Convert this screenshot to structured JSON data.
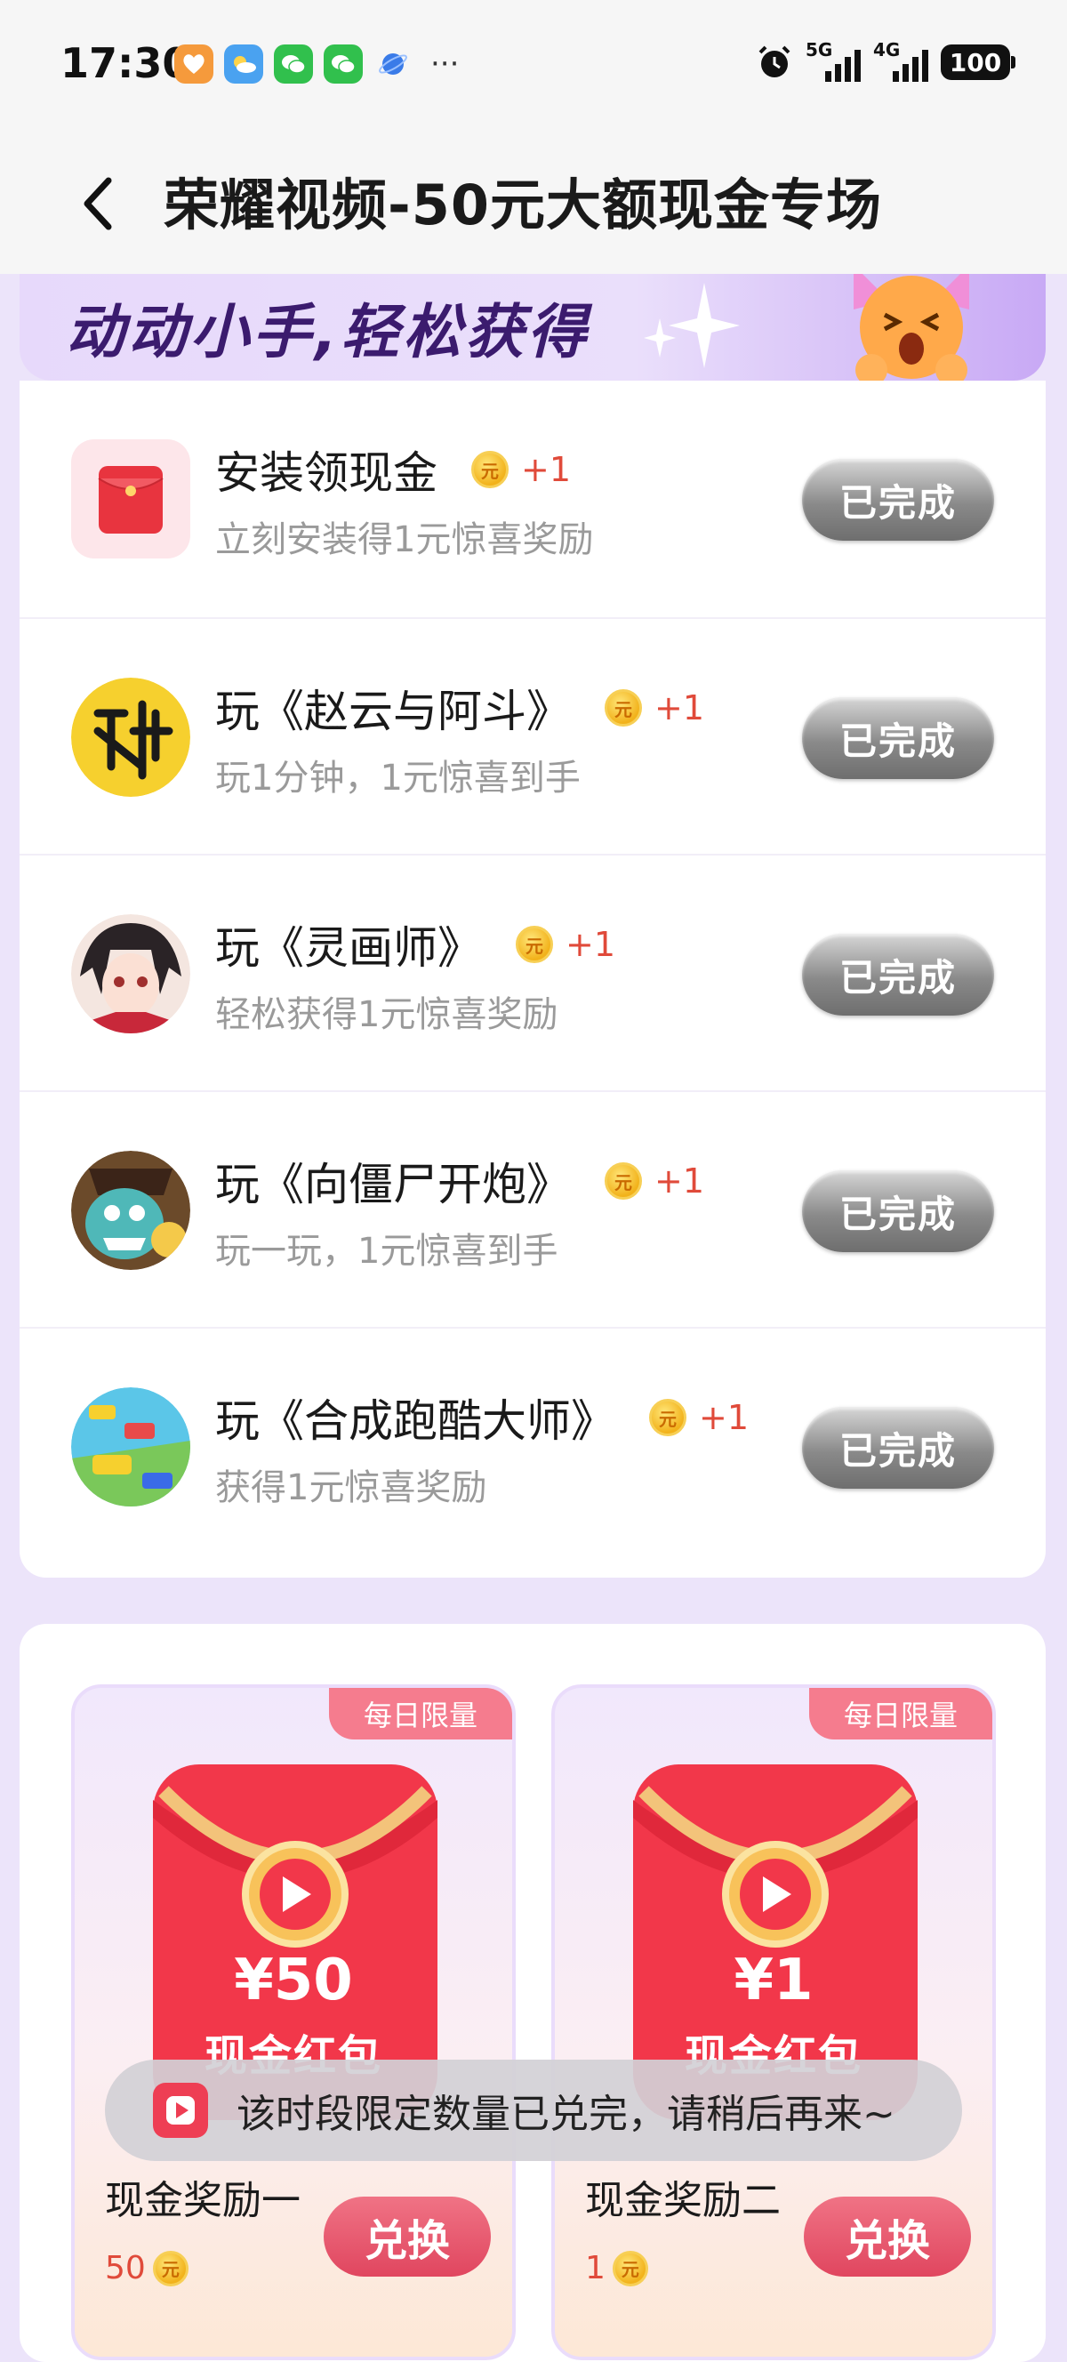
{
  "status_bar": {
    "time": "17:30",
    "network_1": "5G",
    "network_2": "4G",
    "battery": "100"
  },
  "header": {
    "title": "荣耀视频-50元大额现金专场"
  },
  "banner": {
    "text": "动动小手,轻松获得"
  },
  "tasks": [
    {
      "title": "安装领现金",
      "reward": "+1",
      "subtitle": "立刻安装得1元惊喜奖励",
      "button": "已完成",
      "coin_glyph": "元"
    },
    {
      "title": "玩《赵云与阿斗》",
      "reward": "+1",
      "subtitle": "玩1分钟，1元惊喜到手",
      "button": "已完成",
      "coin_glyph": "元"
    },
    {
      "title": "玩《灵画师》",
      "reward": "+1",
      "subtitle": "轻松获得1元惊喜奖励",
      "button": "已完成",
      "coin_glyph": "元"
    },
    {
      "title": "玩《向僵尸开炮》",
      "reward": "+1",
      "subtitle": "玩一玩，1元惊喜到手",
      "button": "已完成",
      "coin_glyph": "元"
    },
    {
      "title": "玩《合成跑酷大师》",
      "reward": "+1",
      "subtitle": "获得1元惊喜奖励",
      "button": "已完成",
      "coin_glyph": "元"
    }
  ],
  "rewards": [
    {
      "badge": "每日限量",
      "amount": "¥50",
      "label": "现金红包",
      "name": "现金奖励一",
      "price": "50",
      "button": "兑换"
    },
    {
      "badge": "每日限量",
      "amount": "¥1",
      "label": "现金红包",
      "name": "现金奖励二",
      "price": "1",
      "button": "兑换"
    }
  ],
  "toast": {
    "text": "该时段限定数量已兑完，请稍后再来~"
  },
  "colors": {
    "accent_purple": "#3b1b6e",
    "reward_red": "#e04a3a",
    "button_pink": "#e0465f",
    "page_bg": "#ece4fa"
  }
}
